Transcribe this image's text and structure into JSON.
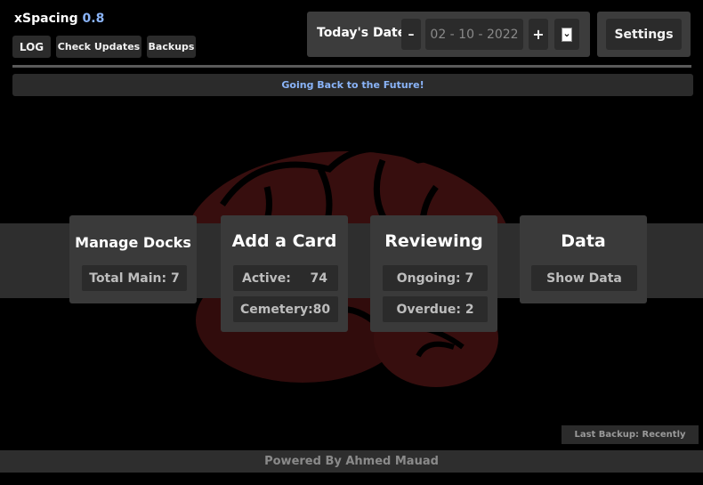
{
  "app": {
    "name": "xSpacing",
    "version": "0.8"
  },
  "top_buttons": {
    "log": "LOG",
    "check_updates": "Check Updates",
    "backups": "Backups"
  },
  "date_bar": {
    "label": "Today's Date",
    "minus": "–",
    "value": "02 - 10 - 2022",
    "plus": "+",
    "dropdown_icon": "⌄"
  },
  "settings": {
    "label": "Settings"
  },
  "banner": {
    "text": "Going Back to the Future!"
  },
  "cards": {
    "manage_docks": {
      "title": "Manage Docks",
      "total_main": "Total Main: 7"
    },
    "add_card": {
      "title": "Add a Card",
      "active_label": "Active:",
      "active_value": "74",
      "cemetery_label": "Cemetery:",
      "cemetery_value": "80"
    },
    "reviewing": {
      "title": "Reviewing",
      "ongoing": "Ongoing: 7",
      "overdue": "Overdue: 2"
    },
    "data": {
      "title": "Data",
      "show_data": "Show Data"
    }
  },
  "last_backup": {
    "text": "Last Backup: Recently"
  },
  "footer": {
    "text": "Powered By Ahmed Mauad"
  },
  "colors": {
    "version": "#8ab4f8",
    "banner_text": "#8ab4f8",
    "brain": "#5a1a1a"
  },
  "background_image": {
    "icon": "brain-icon"
  }
}
